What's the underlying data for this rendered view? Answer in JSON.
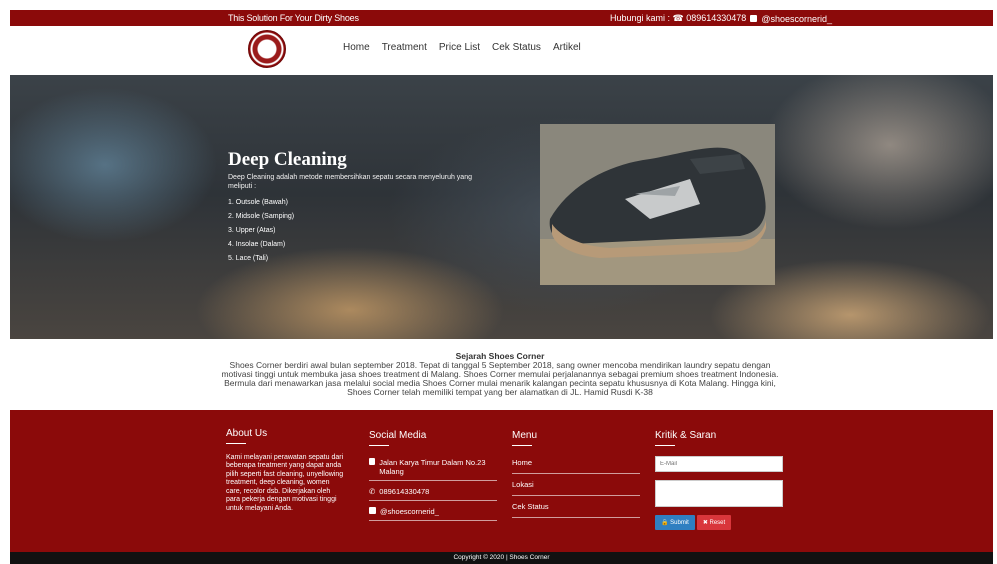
{
  "topbar": {
    "slogan": "This Solution For Your Dirty Shoes",
    "contact_phone": "Hubungi kami : ☎ 089614330478",
    "contact_instagram": "@shoescornerid_"
  },
  "nav": {
    "items": [
      "Home",
      "Treatment",
      "Price List",
      "Cek Status",
      "Artikel"
    ]
  },
  "hero": {
    "title": "Deep Cleaning",
    "description": "Deep Cleaning adalah metode membersihkan sepatu secara menyeluruh yang meliputi :",
    "list": [
      "1. Outsole (Bawah)",
      "2. Midsole (Samping)",
      "3. Upper (Atas)",
      "4. Insolae (Dalam)",
      "5. Lace (Tali)"
    ]
  },
  "history": {
    "title": "Sejarah Shoes Corner",
    "body": "Shoes Corner berdiri awal bulan september 2018. Tepat di tanggal 5 September 2018, sang owner mencoba mendirikan laundry sepatu dengan motivasi tinggi untuk membuka jasa shoes treatment di Malang. Shoes Corner memulai perjalanannya sebagai premium shoes treatment Indonesia. Bermula dari menawarkan jasa melalui social media Shoes Corner mulai menarik kalangan pecinta sepatu khususnya di Kota Malang. Hingga kini, Shoes Corner telah memiliki tempat yang ber alamatkan di JL. Hamid Rusdi K-38"
  },
  "footer": {
    "about_title": "About Us",
    "about_text": "Kami melayani perawatan sepatu dari beberapa treatment yang dapat anda pilih seperti fast cleaning, unyellowing treatment, deep cleaning, women care, recolor dsb. Dikerjakan oleh para pekerja dengan motivasi tinggi untuk melayani Anda.",
    "social_title": "Social Media",
    "address": "Jalan Karya Timur Dalam No.23 Malang",
    "whatsapp": "089614330478",
    "instagram": "@shoescornerid_",
    "menu_title": "Menu",
    "menu_items": [
      "Home",
      "Lokasi",
      "Cek Status"
    ],
    "feedback_title": "Kritik & Saran",
    "email_placeholder": "E-Mail",
    "submit_label": "🔒 Submit",
    "reset_label": "✖ Reset"
  },
  "copyright": "Copyright © 2020 | Shoes Corner"
}
